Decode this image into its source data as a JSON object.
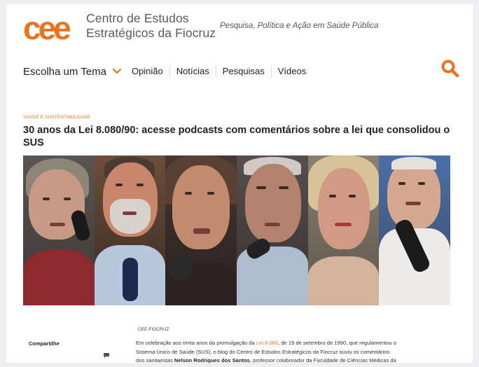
{
  "header": {
    "logo_text": "cee",
    "org_line1": "Centro de Estudos",
    "org_line2": "Estratégicos da Fiocruz",
    "tagline": "Pesquisa, Política e Ação em Saúde Pública"
  },
  "nav": {
    "theme_label": "Escolha um Tema",
    "items": [
      "Opinião",
      "Notícias",
      "Pesquisas",
      "Vídeos"
    ]
  },
  "article": {
    "category": "SAÚDE E SUSTENTABILIDADE",
    "title": "30 anos da Lei 8.080/90: acesse podcasts com comentários sobre a lei que consolidou o SUS",
    "share_label": "Compartilhe",
    "source": "CEE-FIOCRUZ",
    "body": {
      "p1_a": "Em celebração aos trinta anos da promulgação da ",
      "p1_link": "Lei 8.080",
      "p1_b": ", de 19 de setembro de 1990, que regulamentou o",
      "p2": "Sistema Único de Saúde (SUS), o blog do Centro de Estudos Estratégicos da Fiocruz ouviu os comentários",
      "p3_a": "dos sanitaristas ",
      "p3_bold": "Nelson Rodrigues dos Santos",
      "p3_b": ", professor colaborador da Faculdade de Ciências Médicas da"
    }
  },
  "colors": {
    "brand_orange": "#e8741f",
    "text_dark": "#222222",
    "page_bg": "#eceef0"
  },
  "icons": {
    "chevron": "chevron-down-icon",
    "search": "search-icon",
    "comment": "comment-icon"
  }
}
